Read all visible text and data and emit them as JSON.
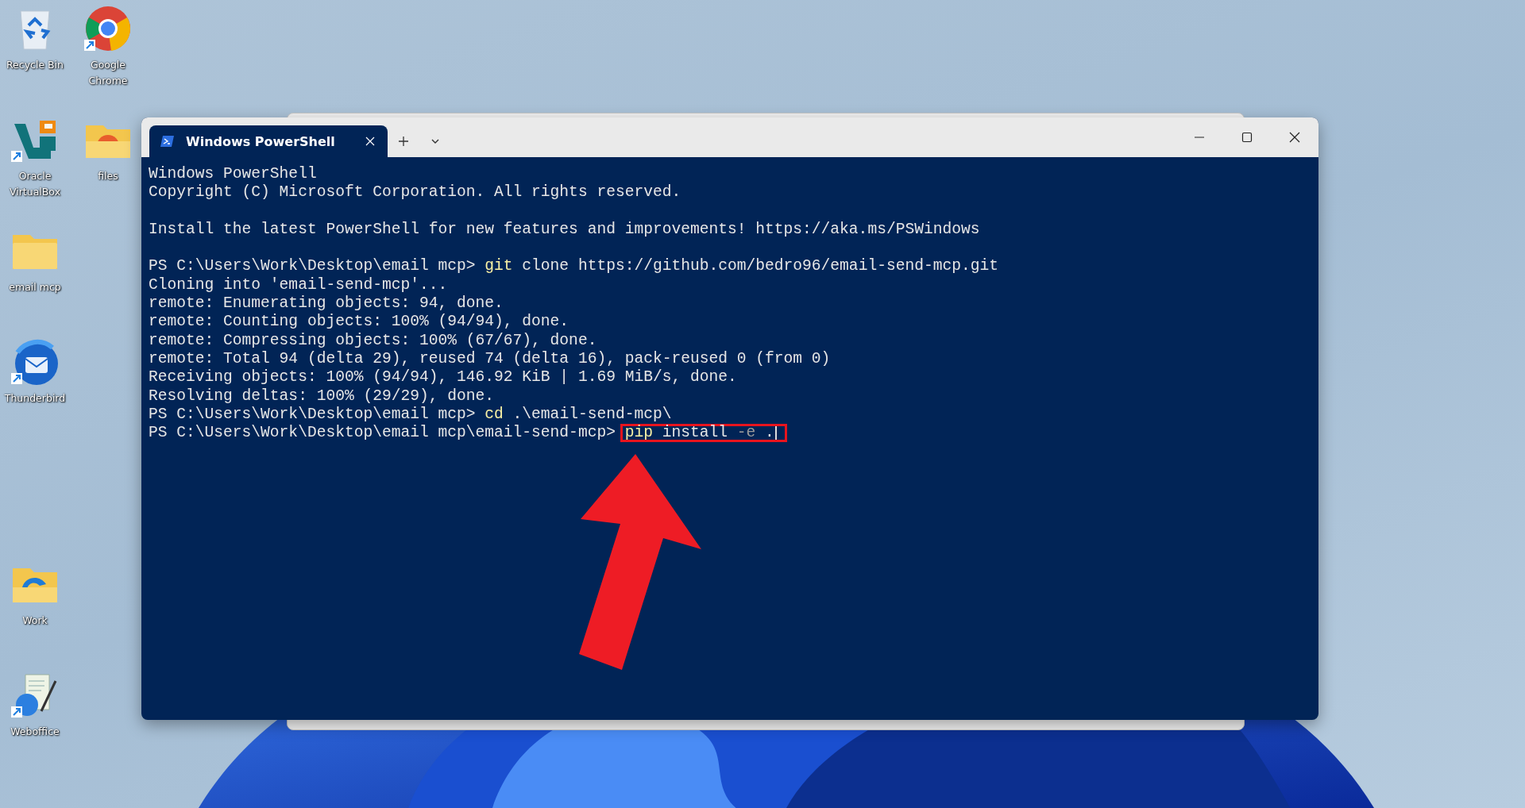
{
  "desktop_icons": [
    {
      "label": "Recycle Bin",
      "kind": "recycle-bin",
      "shortcut": false
    },
    {
      "label": "Google Chrome",
      "kind": "browser",
      "shortcut": true
    },
    {
      "label": "Oracle VirtualBox",
      "kind": "virtualbox",
      "shortcut": true
    },
    {
      "label": "files",
      "kind": "folder-app",
      "shortcut": false
    },
    {
      "label": "email mcp",
      "kind": "folder",
      "shortcut": false
    },
    {
      "label": "Thunderbird",
      "kind": "mail",
      "shortcut": true
    },
    {
      "label": "Work",
      "kind": "folder-wave",
      "shortcut": false
    },
    {
      "label": "Weboffice",
      "kind": "document",
      "shortcut": true
    }
  ],
  "terminal": {
    "tabs": [
      {
        "title": "Windows PowerShell",
        "selected": true
      }
    ],
    "lines": [
      {
        "kind": "text",
        "segments": [
          {
            "kind": "output",
            "text": "Windows PowerShell"
          }
        ]
      },
      {
        "kind": "text",
        "segments": [
          {
            "kind": "output",
            "text": "Copyright (C) Microsoft Corporation. All rights reserved."
          }
        ]
      },
      {
        "kind": "blank"
      },
      {
        "kind": "text",
        "segments": [
          {
            "kind": "output",
            "text": "Install the latest PowerShell for new features and improvements! https://aka.ms/PSWindows"
          }
        ]
      },
      {
        "kind": "blank"
      },
      {
        "kind": "text",
        "segments": [
          {
            "kind": "prompt",
            "text": "PS C:\\Users\\Work\\Desktop\\email mcp> "
          },
          {
            "kind": "command",
            "text": "git"
          },
          {
            "kind": "arg",
            "text": " clone https://github.com/bedro96/email-send-mcp.git"
          }
        ]
      },
      {
        "kind": "text",
        "segments": [
          {
            "kind": "output",
            "text": "Cloning into 'email-send-mcp'..."
          }
        ]
      },
      {
        "kind": "text",
        "segments": [
          {
            "kind": "output",
            "text": "remote: Enumerating objects: 94, done."
          }
        ]
      },
      {
        "kind": "text",
        "segments": [
          {
            "kind": "output",
            "text": "remote: Counting objects: 100% (94/94), done."
          }
        ]
      },
      {
        "kind": "text",
        "segments": [
          {
            "kind": "output",
            "text": "remote: Compressing objects: 100% (67/67), done."
          }
        ]
      },
      {
        "kind": "text",
        "segments": [
          {
            "kind": "output",
            "text": "remote: Total 94 (delta 29), reused 74 (delta 16), pack-reused 0 (from 0)"
          }
        ]
      },
      {
        "kind": "text",
        "segments": [
          {
            "kind": "output",
            "text": "Receiving objects: 100% (94/94), 146.92 KiB | 1.69 MiB/s, done."
          }
        ]
      },
      {
        "kind": "text",
        "segments": [
          {
            "kind": "output",
            "text": "Resolving deltas: 100% (29/29), done."
          }
        ]
      },
      {
        "kind": "text",
        "segments": [
          {
            "kind": "prompt",
            "text": "PS C:\\Users\\Work\\Desktop\\email mcp> "
          },
          {
            "kind": "command",
            "text": "cd"
          },
          {
            "kind": "arg",
            "text": " .\\email-send-mcp\\"
          }
        ]
      },
      {
        "kind": "text",
        "highlighted": true,
        "cursor": true,
        "segments": [
          {
            "kind": "prompt",
            "text": "PS C:\\Users\\Work\\Desktop\\email mcp\\email-send-mcp> "
          },
          {
            "kind": "command",
            "text": "pip"
          },
          {
            "kind": "arg",
            "text": " install "
          },
          {
            "kind": "flag",
            "text": "-e"
          },
          {
            "kind": "arg",
            "text": " ."
          }
        ]
      }
    ]
  }
}
